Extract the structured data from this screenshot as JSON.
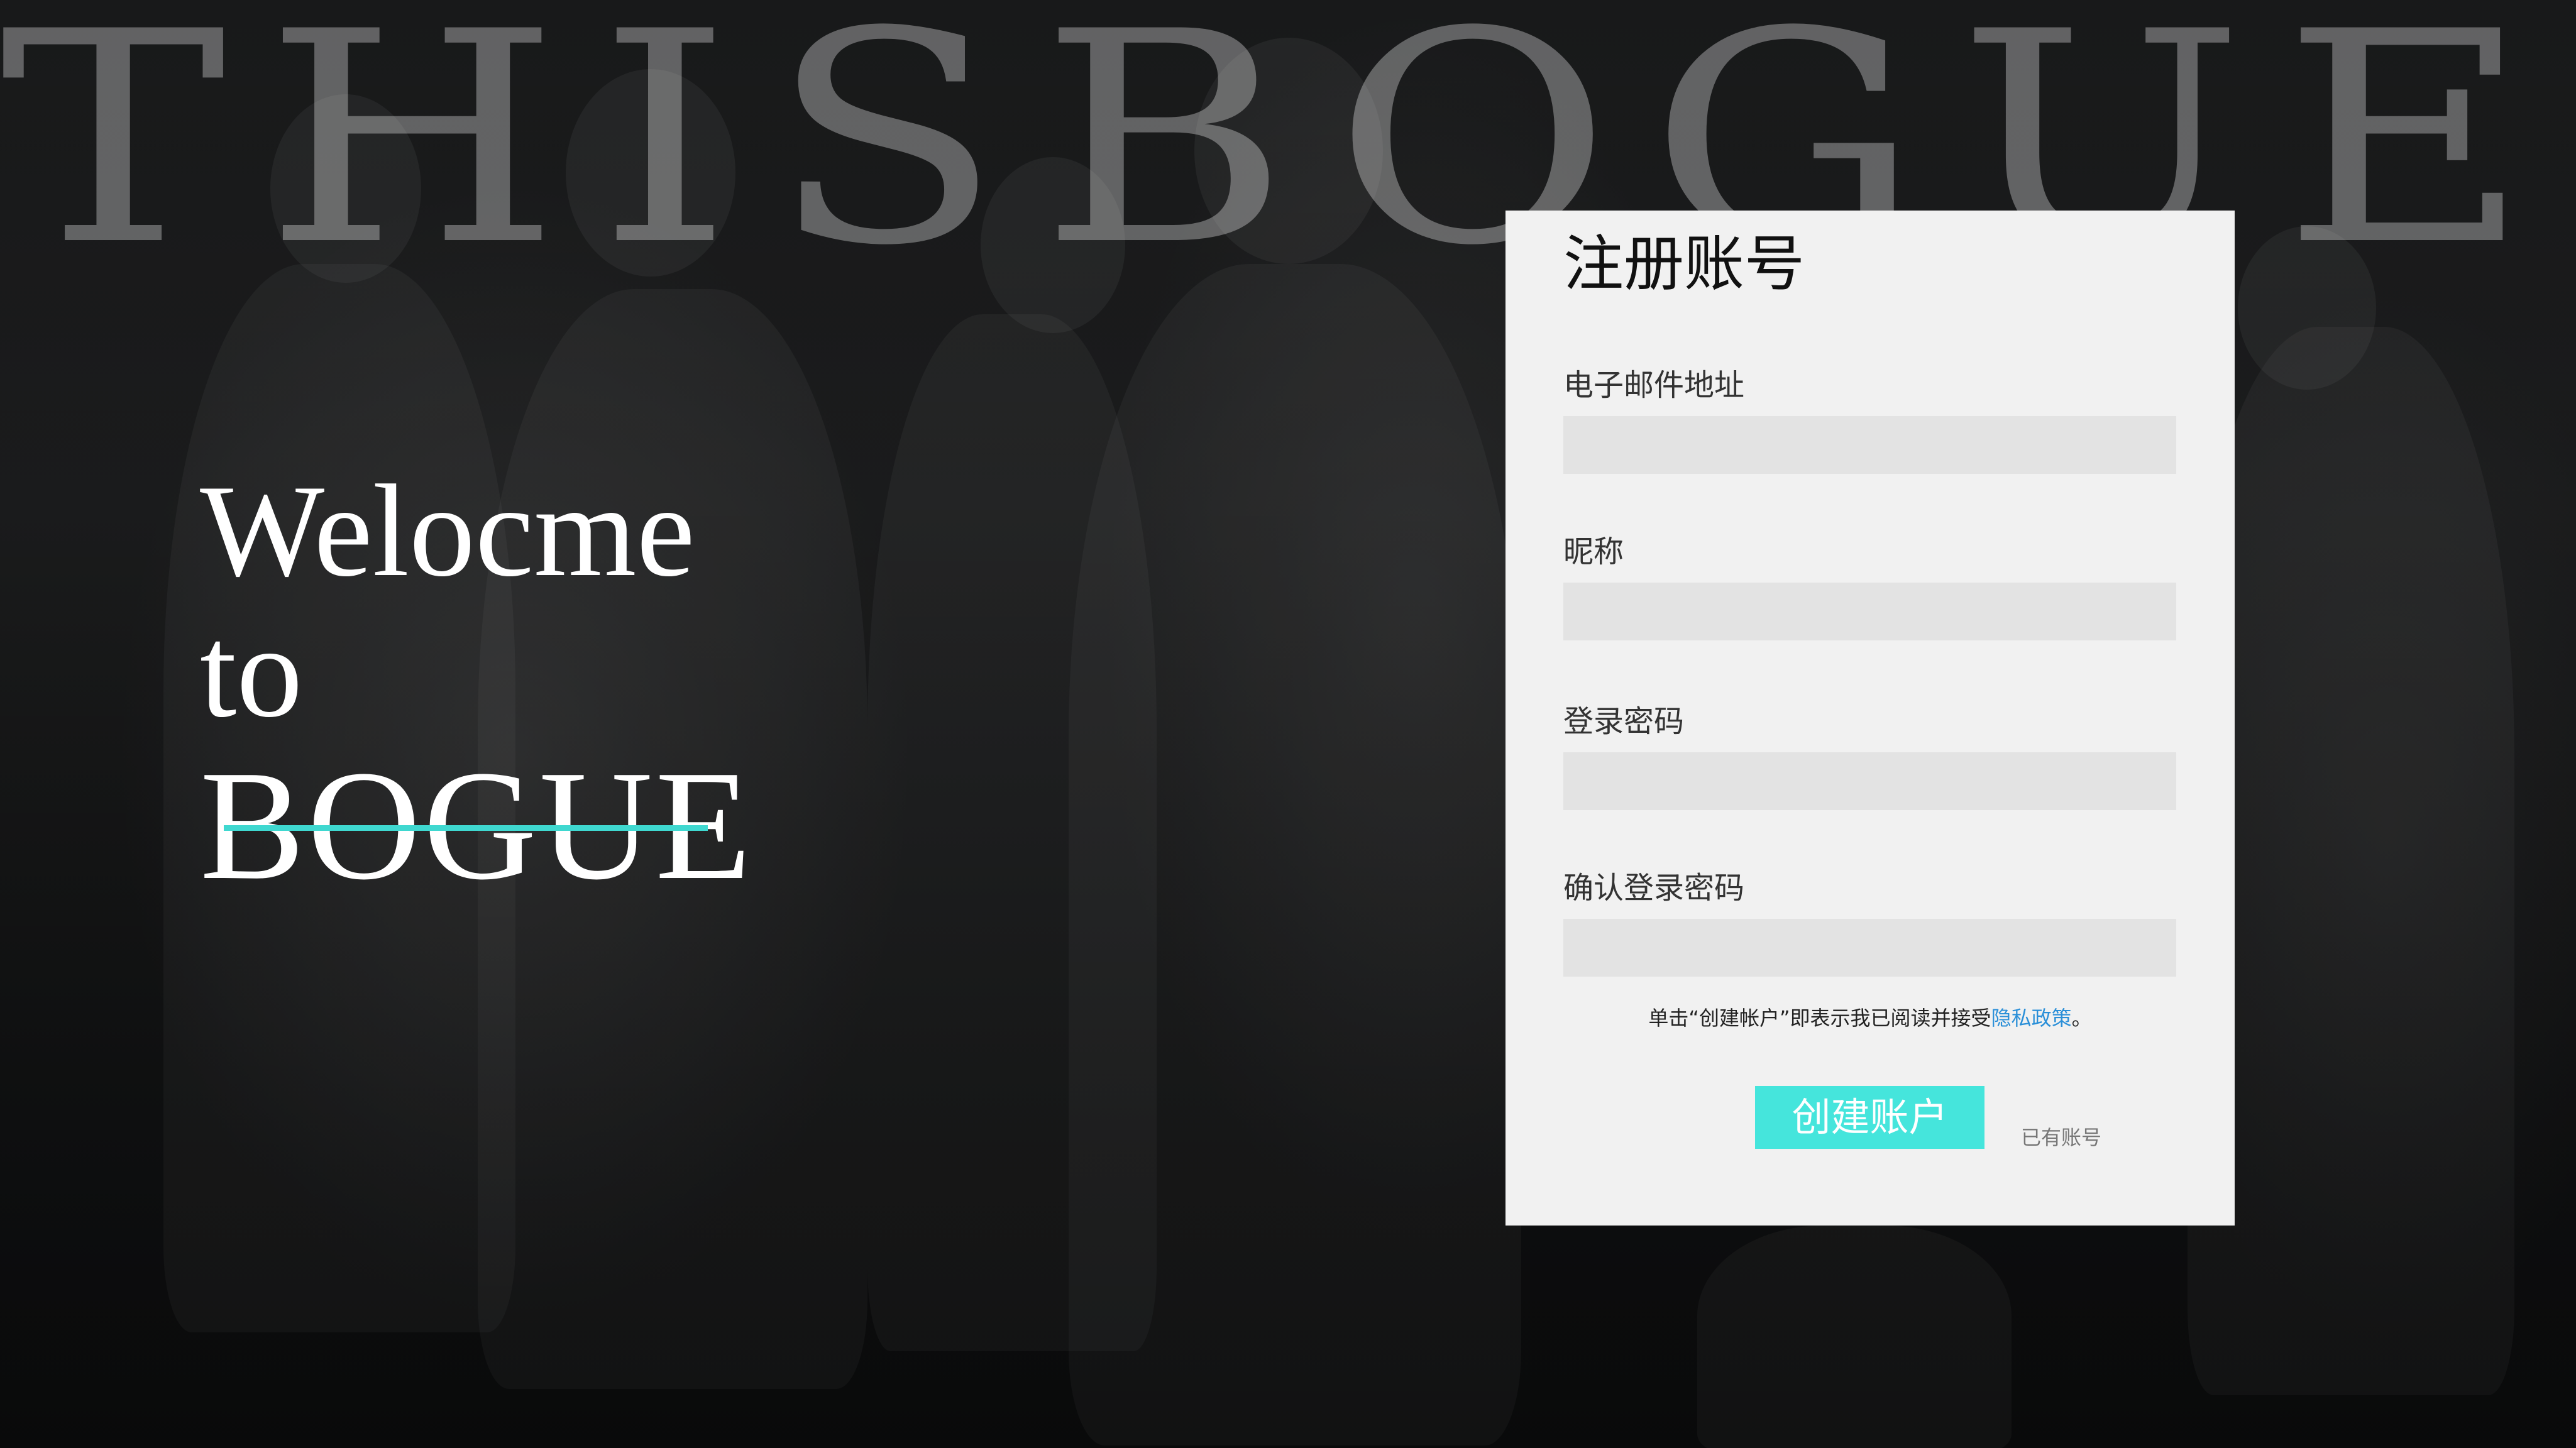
{
  "background": {
    "brand_watermark": "THISBOGUE"
  },
  "welcome": {
    "line1": "Welocme",
    "line2": "to",
    "line3": "BOGUE",
    "accent_color": "#3fd8d0"
  },
  "register_form": {
    "title": "注册账号",
    "email_label": "电子邮件地址",
    "email_value": "",
    "nickname_label": "昵称",
    "nickname_value": "",
    "password_label": "登录密码",
    "password_value": "",
    "confirm_password_label": "确认登录密码",
    "confirm_password_value": "",
    "policy_prefix": "单击“创建帐户”即表示我已阅读并接受",
    "policy_link": "隐私政策",
    "policy_suffix": "。",
    "create_button": "创建账户",
    "have_account_link": "已有账号",
    "button_color": "#45e5dc",
    "link_color": "#2a8fd8"
  }
}
